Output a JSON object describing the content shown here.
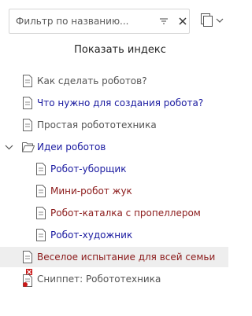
{
  "filter": {
    "placeholder": "Фильтр по названию..."
  },
  "show_index_label": "Показать индекс",
  "tree": {
    "item_1": "Как сделать роботов?",
    "item_2": "Что нужно для создания робота?",
    "item_3": "Простая робототехника",
    "folder": "Идеи роботов",
    "child_1": "Робот-уборщик",
    "child_2": "Мини-робот жук",
    "child_3": "Робот-каталка с пропеллером",
    "child_4": "Робот-художник",
    "item_4": "Веселое испытание для всей семьи",
    "item_5": "Сниппет: Робототехника"
  },
  "colors": {
    "link_blue": "#1a1aa0",
    "link_red": "#8b1a1a",
    "text_gray": "#555555",
    "selected_bg": "#eeeeee"
  }
}
